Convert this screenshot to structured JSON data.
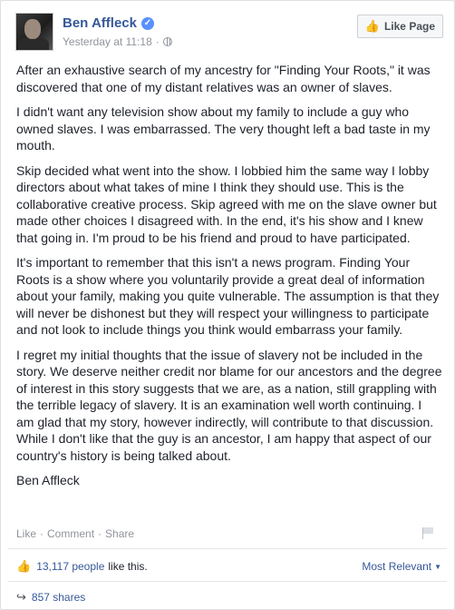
{
  "post": {
    "author": "Ben Affleck",
    "verified_icon": "verified-badge-icon",
    "timestamp": "Yesterday at 11:18",
    "separator": "·",
    "privacy_icon": "globe-icon",
    "like_page_label": "Like Page",
    "paragraphs": [
      "After an exhaustive search of my ancestry for \"Finding Your Roots,\" it was discovered that one of my distant relatives was an owner of slaves.",
      "I didn't want any television show about my family to include a guy who owned slaves. I was embarrassed. The very thought left a bad taste in my mouth.",
      "Skip decided what went into the show. I lobbied him the same way I lobby directors about what takes of mine I think they should use. This is the collaborative creative process. Skip agreed with me on the slave owner but made other choices I disagreed with. In the end, it's his show and I knew that going in. I'm proud to be his friend and proud to have participated.",
      "It's important to remember that this isn't a news program. Finding Your Roots is a show where you voluntarily provide a great deal of information about your family, making you quite vulnerable. The assumption is that they will never be dishonest but they will respect your willingness to participate and not look to include things you think would embarrass your family.",
      "I regret my initial thoughts that the issue of slavery not be included in the story. We deserve neither credit nor blame for our ancestors and the degree of interest in this story suggests that we are, as a nation, still grappling with the terrible legacy of slavery. It is an examination well worth continuing. I am glad that my story, however indirectly, will contribute to that discussion. While I don't like that the guy is an ancestor, I am happy that aspect of our country's history is being talked about.",
      "Ben Affleck"
    ]
  },
  "actions": {
    "like": "Like",
    "comment": "Comment",
    "share": "Share",
    "dot": "·"
  },
  "stats": {
    "likes_count": "13,117 people",
    "likes_suffix": "like this.",
    "sort_label": "Most Relevant",
    "shares": "857 shares"
  },
  "colors": {
    "link": "#365899",
    "muted": "#90949c",
    "verified": "#5890ff"
  }
}
